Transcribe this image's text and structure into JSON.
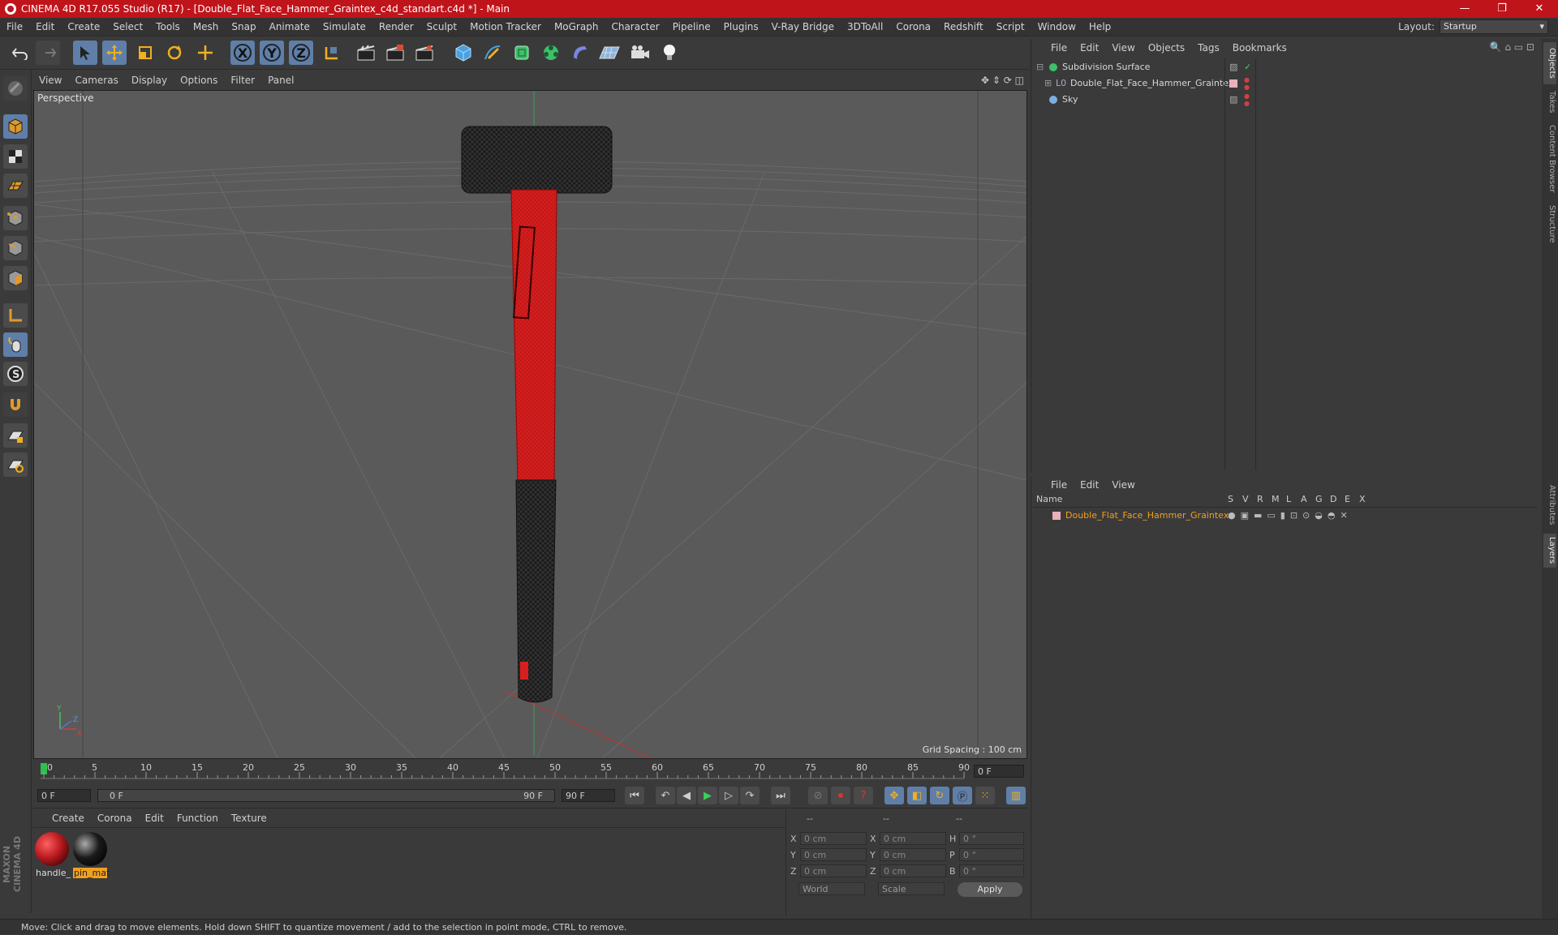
{
  "window": {
    "title": "CINEMA 4D R17.055 Studio (R17) - [Double_Flat_Face_Hammer_Graintex_c4d_standart.c4d *] - Main",
    "controls": [
      "—",
      "❐",
      "✕"
    ]
  },
  "menubar": {
    "items": [
      "File",
      "Edit",
      "Create",
      "Select",
      "Tools",
      "Mesh",
      "Snap",
      "Animate",
      "Simulate",
      "Render",
      "Sculpt",
      "Motion Tracker",
      "MoGraph",
      "Character",
      "Pipeline",
      "Plugins",
      "V-Ray Bridge",
      "3DToAll",
      "Corona",
      "Redshift",
      "Script",
      "Window",
      "Help"
    ],
    "layout_label": "Layout:",
    "layout_value": "Startup"
  },
  "toolbar": {
    "axis_x": "X",
    "axis_y": "Y",
    "axis_z": "Z"
  },
  "viewport": {
    "menu": [
      "View",
      "Cameras",
      "Display",
      "Options",
      "Filter",
      "Panel"
    ],
    "label": "Perspective",
    "grid_spacing": "Grid Spacing : 100 cm"
  },
  "timeline": {
    "ticks": [
      "0",
      "5",
      "10",
      "15",
      "20",
      "25",
      "30",
      "35",
      "40",
      "45",
      "50",
      "55",
      "60",
      "65",
      "70",
      "75",
      "80",
      "85",
      "90"
    ],
    "current_frame": "0 F",
    "start_field": "0 F",
    "range_start": "0 F",
    "range_end": "90 F",
    "end_field": "90 F"
  },
  "materials": {
    "menu": [
      "Create",
      "Corona",
      "Edit",
      "Function",
      "Texture"
    ],
    "items": [
      {
        "name": "handle_",
        "color": "#b81a1f",
        "selected": false
      },
      {
        "name": "pin_mat",
        "color": "#1a1a1a",
        "selected": true
      }
    ]
  },
  "coordinates": {
    "header": [
      "--",
      "--",
      "--"
    ],
    "rows": [
      {
        "a": "X",
        "av": "0 cm",
        "b": "X",
        "bv": "0 cm",
        "c": "H",
        "cv": "0 °"
      },
      {
        "a": "Y",
        "av": "0 cm",
        "b": "Y",
        "bv": "0 cm",
        "c": "P",
        "cv": "0 °"
      },
      {
        "a": "Z",
        "av": "0 cm",
        "b": "Z",
        "bv": "0 cm",
        "c": "B",
        "cv": "0 °"
      }
    ],
    "mode1": "World",
    "mode2": "Scale",
    "apply": "Apply"
  },
  "status": "Move: Click and drag to move elements. Hold down SHIFT to quantize movement / add to the selection in point mode, CTRL to remove.",
  "objects": {
    "menu": [
      "File",
      "Edit",
      "View",
      "Objects",
      "Tags",
      "Bookmarks"
    ],
    "items": [
      {
        "name": "Subdivision Surface"
      },
      {
        "name": "Double_Flat_Face_Hammer_Graintex"
      },
      {
        "name": "Sky"
      }
    ]
  },
  "layers": {
    "menu": [
      "File",
      "Edit",
      "View"
    ],
    "columns": [
      "Name",
      "S",
      "V",
      "R",
      "M",
      "L",
      "A",
      "G",
      "D",
      "E",
      "X"
    ],
    "row_name": "Double_Flat_Face_Hammer_Graintex"
  },
  "side_tabs": [
    "Objects",
    "Takes",
    "Content Browser",
    "Structure",
    "Attributes",
    "Layers"
  ],
  "colors": {
    "titlebar": "#c0141b",
    "accent_blue": "#5f7fa8",
    "handle_red": "#d81e1e",
    "layer_orange": "#f0a020"
  }
}
